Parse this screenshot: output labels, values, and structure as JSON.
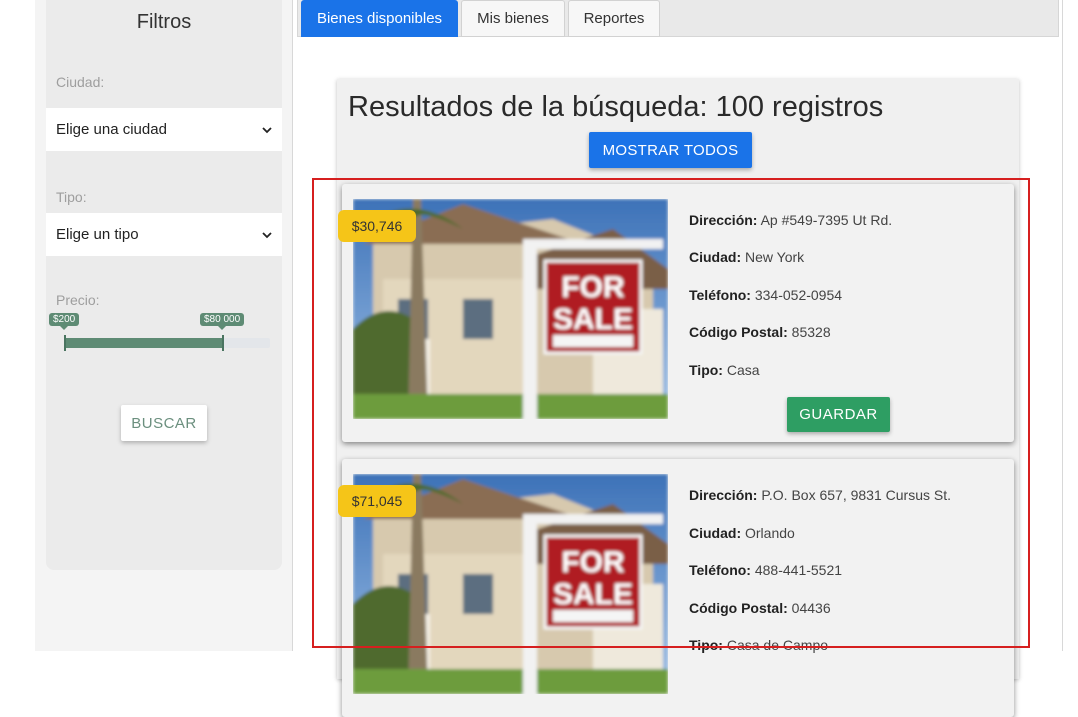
{
  "filters": {
    "title": "Filtros",
    "city_label": "Ciudad:",
    "city_value": "Elige una ciudad",
    "type_label": "Tipo:",
    "type_value": "Elige un tipo",
    "price_label": "Precio:",
    "price_min": "$200",
    "price_max": "$80 000",
    "price_range_fill_fraction": 0.77,
    "search_label": "BUSCAR"
  },
  "tabs": [
    {
      "label": "Bienes disponibles",
      "active": true
    },
    {
      "label": "Mis bienes",
      "active": false
    },
    {
      "label": "Reportes",
      "active": false
    }
  ],
  "results": {
    "title": "Resultados de la búsqueda: 100 registros",
    "show_all_label": "MOSTRAR TODOS"
  },
  "field_labels": {
    "address": "Dirección:",
    "city": "Ciudad:",
    "phone": "Teléfono:",
    "postal": "Código Postal:",
    "type": "Tipo:"
  },
  "cards": [
    {
      "price": "$30,746",
      "address": "Ap #549-7395 Ut Rd.",
      "city": "New York",
      "phone": "334-052-0954",
      "postal": "85328",
      "type": "Casa",
      "save_label": "GUARDAR"
    },
    {
      "price": "$71,045",
      "address": "P.O. Box 657, 9831 Cursus St.",
      "city": "Orlando",
      "phone": "488-441-5521",
      "postal": "04436",
      "type": "Casa de Campo"
    }
  ],
  "image": {
    "sign_text_1": "FOR",
    "sign_text_2": "SALE"
  },
  "colors": {
    "primary": "#1a73e8",
    "success": "#2e9e63",
    "badge": "#f5c518",
    "slider": "#5e8b74",
    "highlight": "#d61f1f"
  }
}
